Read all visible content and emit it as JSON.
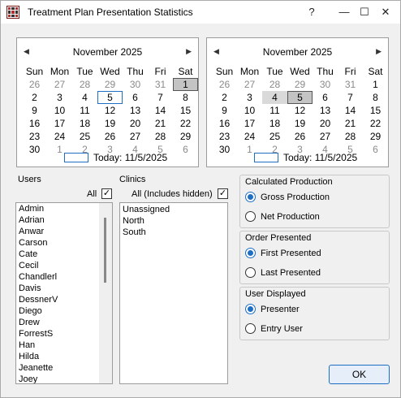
{
  "window": {
    "title": "Treatment Plan Presentation Statistics",
    "help": "?",
    "minimize": "—",
    "maximize": "☐",
    "close": "✕"
  },
  "calendar_left": {
    "month": "November 2025",
    "prev": "◀",
    "next": "▶",
    "days": [
      "Sun",
      "Mon",
      "Tue",
      "Wed",
      "Thu",
      "Fri",
      "Sat"
    ],
    "weeks": [
      [
        "26",
        "27",
        "28",
        "29",
        "30",
        "31",
        "1"
      ],
      [
        "2",
        "3",
        "4",
        "5",
        "6",
        "7",
        "8"
      ],
      [
        "9",
        "10",
        "11",
        "12",
        "13",
        "14",
        "15"
      ],
      [
        "16",
        "17",
        "18",
        "19",
        "20",
        "21",
        "22"
      ],
      [
        "23",
        "24",
        "25",
        "26",
        "27",
        "28",
        "29"
      ],
      [
        "30",
        "1",
        "2",
        "3",
        "4",
        "5",
        "6"
      ]
    ],
    "today_label": "Today: 11/5/2025"
  },
  "calendar_right": {
    "month": "November 2025",
    "prev": "◀",
    "next": "▶",
    "days": [
      "Sun",
      "Mon",
      "Tue",
      "Wed",
      "Thu",
      "Fri",
      "Sat"
    ],
    "weeks": [
      [
        "26",
        "27",
        "28",
        "29",
        "30",
        "31",
        "1"
      ],
      [
        "2",
        "3",
        "4",
        "5",
        "6",
        "7",
        "8"
      ],
      [
        "9",
        "10",
        "11",
        "12",
        "13",
        "14",
        "15"
      ],
      [
        "16",
        "17",
        "18",
        "19",
        "20",
        "21",
        "22"
      ],
      [
        "23",
        "24",
        "25",
        "26",
        "27",
        "28",
        "29"
      ],
      [
        "30",
        "1",
        "2",
        "3",
        "4",
        "5",
        "6"
      ]
    ],
    "today_label": "Today: 11/5/2025"
  },
  "users": {
    "label": "Users",
    "all_label": "All",
    "all_checked": "✓",
    "items": [
      "Admin",
      "Adrian",
      "Anwar",
      "Carson",
      "Cate",
      "Cecil",
      "Chandlerl",
      "Davis",
      "DessnerV",
      "Diego",
      "Drew",
      "ForrestS",
      "Han",
      "Hilda",
      "Jeanette",
      "Joey"
    ]
  },
  "clinics": {
    "label": "Clinics",
    "all_label": "All (Includes hidden)",
    "all_checked": "✓",
    "items": [
      "Unassigned",
      "North",
      "South"
    ]
  },
  "calc_production": {
    "title": "Calculated Production",
    "options": [
      "Gross Production",
      "Net Production"
    ]
  },
  "order_presented": {
    "title": "Order Presented",
    "options": [
      "First Presented",
      "Last Presented"
    ]
  },
  "user_displayed": {
    "title": "User Displayed",
    "options": [
      "Presenter",
      "Entry User"
    ]
  },
  "ok_label": "OK",
  "colors": {
    "accent": "#1e6ec4"
  }
}
